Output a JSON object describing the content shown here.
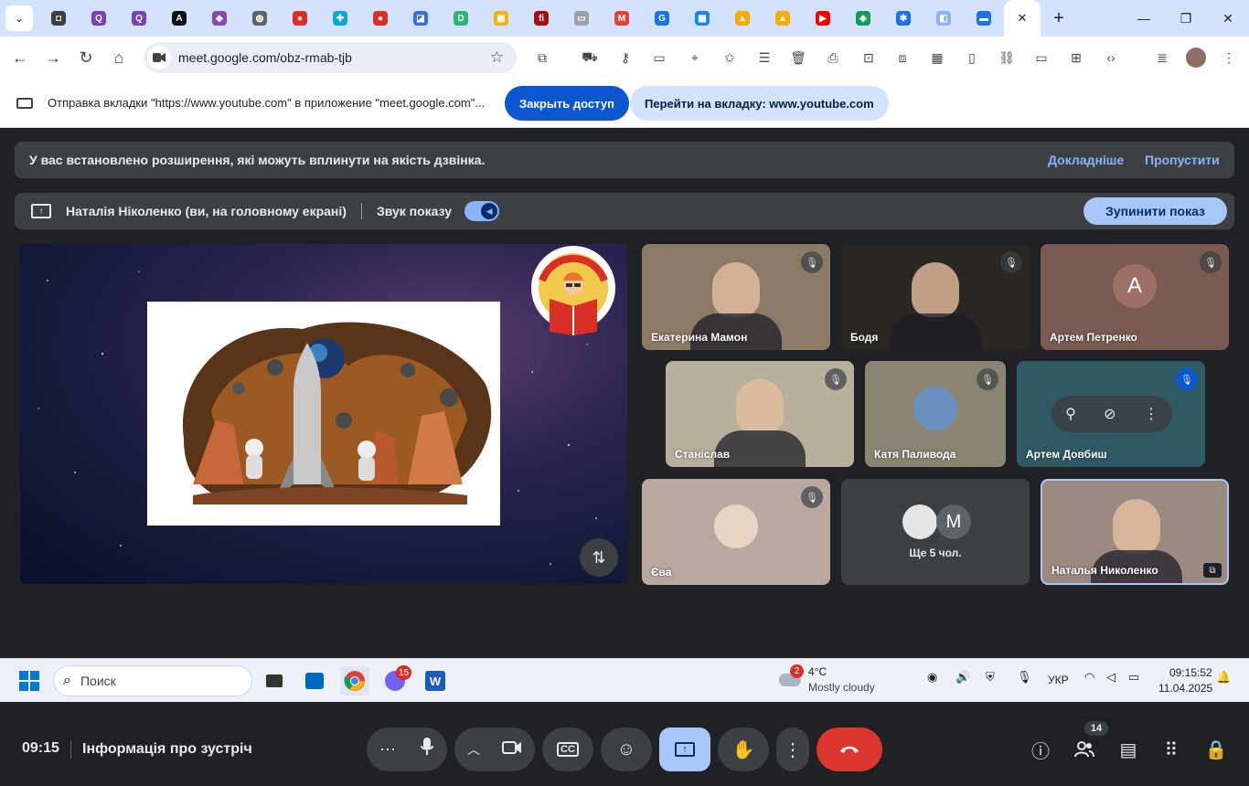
{
  "browser": {
    "tab_favicons": [
      {
        "name": "tab-icon-1",
        "color": "#3c4043",
        "glyph": "◘"
      },
      {
        "name": "tab-icon-2",
        "color": "#7b3fb8",
        "glyph": "Q"
      },
      {
        "name": "tab-icon-3",
        "color": "#7b3fb8",
        "glyph": "Q"
      },
      {
        "name": "tab-icon-4",
        "color": "#111111",
        "glyph": "A"
      },
      {
        "name": "tab-icon-5",
        "color": "#8e44ad",
        "glyph": "◆"
      },
      {
        "name": "tab-icon-6",
        "color": "#5f6368",
        "glyph": "◍"
      },
      {
        "name": "tab-icon-7",
        "color": "#d93025",
        "glyph": "●"
      },
      {
        "name": "tab-icon-8",
        "color": "#12a4d9",
        "glyph": "✚"
      },
      {
        "name": "tab-icon-9",
        "color": "#d93025",
        "glyph": "●"
      },
      {
        "name": "tab-icon-10",
        "color": "#3a6fd8",
        "glyph": "◪"
      },
      {
        "name": "tab-icon-11",
        "color": "#2bb673",
        "glyph": "D"
      },
      {
        "name": "tab-icon-12",
        "color": "#f4b400",
        "glyph": "▣"
      },
      {
        "name": "tab-icon-13",
        "color": "#a50e0e",
        "glyph": "fi"
      },
      {
        "name": "tab-icon-14",
        "color": "#9aa0a6",
        "glyph": "▭"
      },
      {
        "name": "tab-icon-15",
        "color": "#ea4335",
        "glyph": "M"
      },
      {
        "name": "tab-icon-16",
        "color": "#1a73e8",
        "glyph": "G"
      },
      {
        "name": "tab-icon-17",
        "color": "#1e88e5",
        "glyph": "▦"
      },
      {
        "name": "tab-icon-18",
        "color": "#f9ab00",
        "glyph": "▲"
      },
      {
        "name": "tab-icon-19",
        "color": "#f9ab00",
        "glyph": "▲"
      },
      {
        "name": "tab-icon-20",
        "color": "#ff0000",
        "glyph": "▶"
      },
      {
        "name": "tab-icon-21",
        "color": "#0f9d58",
        "glyph": "◈"
      },
      {
        "name": "tab-icon-22",
        "color": "#1a73e8",
        "glyph": "✱"
      },
      {
        "name": "tab-icon-23",
        "color": "#8ab4f8",
        "glyph": "◧"
      },
      {
        "name": "tab-icon-24",
        "color": "#1a73e8",
        "glyph": "▬"
      }
    ],
    "close_tab": "✕",
    "new_tab": "+",
    "url": "meet.google.com/obz-rmab-tjb"
  },
  "infobar": {
    "message": "Отправка вкладки \"https://www.youtube.com\" в приложение \"meet.google.com\"...",
    "close_access": "Закрыть доступ",
    "goto_tab": "Перейти на вкладку: www.youtube.com"
  },
  "meet": {
    "banner_text": "У вас встановлено розширення, які можуть вплинути на якість дзвінка.",
    "learn_more": "Докладніше",
    "skip": "Пропустити",
    "presenter_text": "Наталія Ніколенко (ви, на головному екрані)",
    "share_audio": "Звук показу",
    "stop_sharing": "Зупинити показ",
    "participants": [
      {
        "name": "Екатерина Мамон",
        "bg": "#8a7a66"
      },
      {
        "name": "Бодя",
        "bg": "#2a2722"
      },
      {
        "name": "Артем Петренко",
        "bg": "#7a5b52",
        "initial": "A"
      },
      {
        "name": "Станіслав",
        "bg": "#b6b09c"
      },
      {
        "name": "Катя Паливода",
        "bg": "#8a8572"
      },
      {
        "name": "Артем Довбиш",
        "bg": "#2f5a63"
      },
      {
        "name": "Єва",
        "bg": "#b9a7a0"
      },
      {
        "name": "Ще 5 чол.",
        "bg": "#3c4043",
        "initial": "M"
      },
      {
        "name": "Наталья Николенко",
        "bg": "#9b8a80"
      }
    ],
    "time": "09:15",
    "meeting_info": "Інформація про зустріч",
    "people_count": "14"
  },
  "taskbar": {
    "search_placeholder": "Поиск",
    "chat_badge": "15",
    "weather_badge": "2",
    "temp": "4°C",
    "weather": "Mostly cloudy",
    "lang": "УКР",
    "clock_time": "09:15:52",
    "clock_date": "11.04.2025"
  }
}
